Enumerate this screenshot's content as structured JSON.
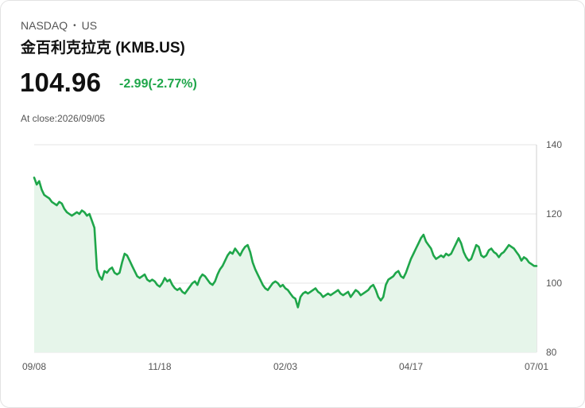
{
  "header": {
    "exchange": "NASDAQ",
    "separator": "•",
    "market": "US",
    "title": "金百利克拉克 (KMB.US)",
    "price": "104.96",
    "change_abs": "-2.99",
    "change_pct": "(-2.77%)",
    "close_prefix": "At close:",
    "close_date": "2026/09/05"
  },
  "colors": {
    "line": "#1fa64a",
    "fill": "#e6f5ea",
    "change": "#1fa64a",
    "grid": "#e6e6e6"
  },
  "chart_data": {
    "type": "area",
    "title": "",
    "xlabel": "",
    "ylabel": "",
    "ylim": [
      80,
      140
    ],
    "yticks": [
      140,
      120,
      100,
      80
    ],
    "grid": true,
    "y_axis_position": "right",
    "x_tick_labels": [
      "09/08",
      "11/18",
      "02/03",
      "04/17",
      "07/01"
    ],
    "x_tick_index": [
      0,
      50,
      100,
      150,
      200
    ],
    "series": [
      {
        "values": [
          130.5,
          128.5,
          129.5,
          127,
          125.5,
          125,
          124.5,
          123.5,
          123,
          122.5,
          123.5,
          123,
          121.5,
          120.5,
          120,
          119.5,
          120,
          120.5,
          120,
          121,
          120.5,
          119.5,
          120,
          118,
          116,
          104,
          102,
          101,
          103.5,
          103,
          104,
          104.5,
          103,
          102.5,
          103,
          106,
          108.5,
          108,
          106.5,
          105,
          103.5,
          102,
          101.5,
          102,
          102.5,
          101,
          100.5,
          101,
          100.5,
          99.5,
          99,
          100,
          101.5,
          100.5,
          101,
          99.5,
          98.5,
          98,
          98.5,
          97.5,
          97,
          98,
          99,
          100,
          100.5,
          99.5,
          101.5,
          102.5,
          102,
          101,
          100,
          99.5,
          100.5,
          102.5,
          104,
          105,
          106.5,
          108,
          109,
          108.5,
          110,
          109,
          108,
          109.5,
          110.5,
          111,
          109,
          106,
          104,
          102.5,
          101,
          99.5,
          98.5,
          98,
          99,
          100,
          100.5,
          100,
          99,
          99.5,
          98.5,
          98,
          97,
          96,
          95.5,
          93,
          96,
          97,
          97.5,
          97,
          97.5,
          98,
          98.5,
          97.5,
          97,
          96,
          96.5,
          97,
          96.5,
          97,
          97.5,
          98,
          97,
          96.5,
          97,
          97.5,
          96,
          97,
          98,
          97.5,
          96.5,
          97,
          97.5,
          98,
          99,
          99.5,
          98,
          96,
          95,
          96,
          99.5,
          101,
          101.5,
          102,
          103,
          103.5,
          102,
          101.5,
          103,
          105,
          107,
          108.5,
          110,
          111.5,
          113,
          114,
          112,
          111,
          110,
          108,
          107,
          107.5,
          108,
          107.5,
          108.5,
          108,
          108.5,
          110,
          111.5,
          113,
          111.5,
          109,
          107.5,
          106.5,
          107,
          109,
          111,
          110.5,
          108,
          107.5,
          108,
          109.5,
          110,
          109,
          108.5,
          107.5,
          108.5,
          109,
          110,
          111,
          110.5,
          110,
          109,
          108,
          106.5,
          107.5,
          107,
          106,
          105.5,
          105,
          104.96
        ]
      }
    ]
  }
}
